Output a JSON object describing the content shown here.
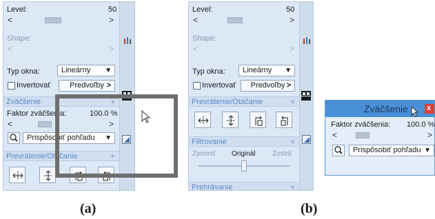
{
  "panel_a": {
    "level_label": "Level:",
    "level_value": "50",
    "level_fraction": 0.5,
    "shape_label": "Shape:",
    "window_type_label": "Typ okna:",
    "window_type_value": "Lineárny",
    "invert_label": "Invertovať",
    "presets_label": "Predvoľby",
    "section_zoom": "Zväčšenie",
    "zoom_factor_label": "Faktor zväčšenia:",
    "zoom_factor_value": "100.0 %",
    "fit_view_value": "Prispôsobiť pohľadu",
    "section_flip": "Prevrátenie/Otáčanie"
  },
  "panel_b": {
    "level_label": "Level:",
    "level_value": "50",
    "shape_label": "Shape:",
    "window_type_label": "Typ okna:",
    "window_type_value": "Lineárny",
    "invert_label": "Invertovať",
    "presets_label": "Predvoľby",
    "section_flip": "Prevrátenie/Otáčanie",
    "section_filter": "Filtrovanie",
    "soften_label": "Zjemniť",
    "original_label": "Originál",
    "sharpen_label": "Zostriť",
    "section_playback": "Prehrávanie"
  },
  "floating_window": {
    "title": "Zväčšenie",
    "close_label": "x",
    "zoom_factor_label": "Faktor zväčšenia:",
    "zoom_factor_value": "100.0 %",
    "fit_view_value": "Prispôsobiť pohľadu"
  },
  "captions": {
    "a": "(a)",
    "b": "(b)"
  },
  "colors": {
    "panel_bg": "#dce8f6",
    "section_text": "#5a8ac8",
    "title_accent": "#4a90d9",
    "close_red": "#e03c3c"
  },
  "icons": [
    "magnifier-icon",
    "flip-horizontal-icon",
    "flip-vertical-icon",
    "rotate-left-icon",
    "rotate-right-icon",
    "layout-grid-icon",
    "window-bars-icon",
    "corner-resize-icon",
    "mouse-cursor-icon"
  ]
}
